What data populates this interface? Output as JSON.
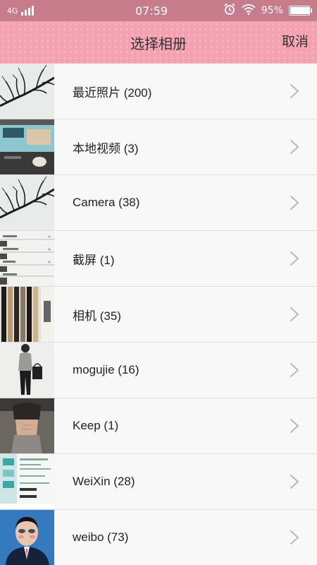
{
  "status_bar": {
    "network": "4G",
    "time": "07:59",
    "battery_percent": "95%",
    "battery_level": 0.95,
    "icons": [
      "signal-icon",
      "alarm-icon",
      "wifi-icon",
      "battery-icon"
    ]
  },
  "header": {
    "title": "选择相册",
    "cancel_label": "取消",
    "color": "#f4a2b2"
  },
  "albums": [
    {
      "label": "最近照片 (200)",
      "thumb": "tree-branch-photo"
    },
    {
      "label": "本地视频 (3)",
      "thumb": "desk-screen-photo"
    },
    {
      "label": "Camera (38)",
      "thumb": "tree-branch-photo"
    },
    {
      "label": "截屏 (1)",
      "thumb": "screenshot-list"
    },
    {
      "label": "相机 (35)",
      "thumb": "frame-samples-photo"
    },
    {
      "label": "mogujie (16)",
      "thumb": "fashion-photo"
    },
    {
      "label": "Keep (1)",
      "thumb": "fitness-photo"
    },
    {
      "label": "WeiXin (28)",
      "thumb": "chat-screenshot"
    },
    {
      "label": "weibo (73)",
      "thumb": "portrait-photo"
    }
  ]
}
